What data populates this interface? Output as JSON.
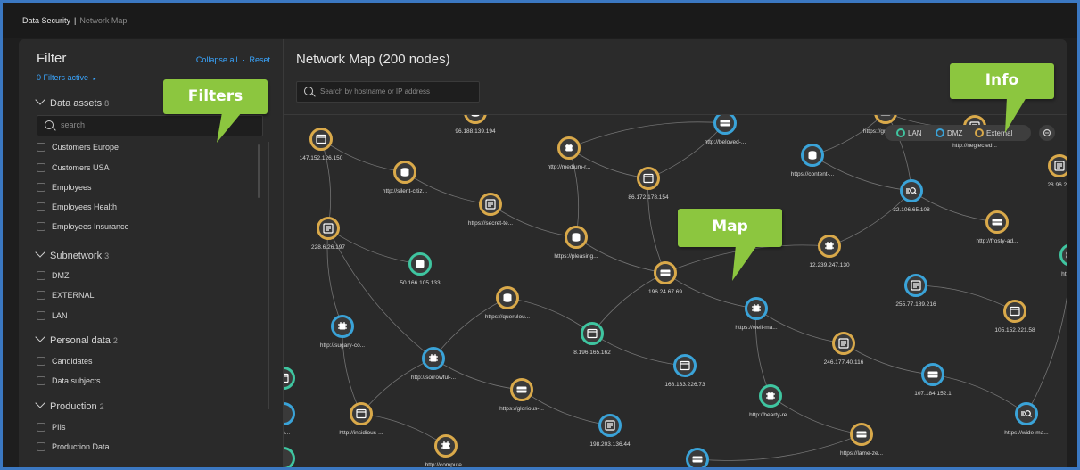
{
  "breadcrumb": {
    "root": "Data Security",
    "separator": "|",
    "current": "Network Map"
  },
  "filter": {
    "title": "Filter",
    "collapse_all": "Collapse all",
    "reset": "Reset",
    "active": "0 Filters active",
    "search_placeholder": "search",
    "groups": [
      {
        "label": "Data assets",
        "count": "8",
        "items": [
          "Customers Europe",
          "Customers USA",
          "Employees",
          "Employees Health",
          "Employees Insurance"
        ]
      },
      {
        "label": "Subnetwork",
        "count": "3",
        "items": [
          "DMZ",
          "EXTERNAL",
          "LAN"
        ]
      },
      {
        "label": "Personal data",
        "count": "2",
        "items": [
          "Candidates",
          "Data subjects"
        ]
      },
      {
        "label": "Production",
        "count": "2",
        "items": [
          "PIIs",
          "Production Data"
        ]
      }
    ]
  },
  "map": {
    "title": "Network Map (200 nodes)",
    "search_placeholder": "Search by hostname or IP address",
    "legend": [
      "LAN",
      "DMZ",
      "External"
    ],
    "nodes": [
      {
        "label": "96.188.139.194",
        "type": "external",
        "icon": "database"
      },
      {
        "label": "147.152.126.150",
        "type": "external",
        "icon": "window"
      },
      {
        "label": "http://beloved-...",
        "type": "dmz",
        "icon": "server"
      },
      {
        "label": "http://medium-r...",
        "type": "external",
        "icon": "chip"
      },
      {
        "label": "https://grove-ch...",
        "type": "external",
        "icon": "server"
      },
      {
        "label": "http://neglected...",
        "type": "external",
        "icon": "list"
      },
      {
        "label": "https://content-...",
        "type": "dmz",
        "icon": "database"
      },
      {
        "label": "http://silent-citiz...",
        "type": "external",
        "icon": "database"
      },
      {
        "label": "86.172.178.154",
        "type": "external",
        "icon": "window"
      },
      {
        "label": "32.106.65.108",
        "type": "dmz",
        "icon": "search"
      },
      {
        "label": "28.96.2...",
        "type": "external",
        "icon": "list"
      },
      {
        "label": "https://secret-te...",
        "type": "external",
        "icon": "list"
      },
      {
        "label": "228.6.26.197",
        "type": "external",
        "icon": "list"
      },
      {
        "label": "https://pleasing...",
        "type": "external",
        "icon": "database"
      },
      {
        "label": "http://frosty-ad...",
        "type": "external",
        "icon": "server"
      },
      {
        "label": "50.166.105.133",
        "type": "lan",
        "icon": "database"
      },
      {
        "label": "196.24.67.69",
        "type": "external",
        "icon": "server"
      },
      {
        "label": "12.239.247.130",
        "type": "external",
        "icon": "chip"
      },
      {
        "label": "http://...",
        "type": "lan",
        "icon": "server"
      },
      {
        "label": "255.77.189.216",
        "type": "dmz",
        "icon": "list"
      },
      {
        "label": "https://querulou...",
        "type": "external",
        "icon": "database"
      },
      {
        "label": "https://well-ma...",
        "type": "dmz",
        "icon": "chip"
      },
      {
        "label": "105.152.221.58",
        "type": "external",
        "icon": "window"
      },
      {
        "label": "http://sugary-co...",
        "type": "dmz",
        "icon": "chip"
      },
      {
        "label": "8.196.165.162",
        "type": "lan",
        "icon": "window"
      },
      {
        "label": "246.177.40.116",
        "type": "external",
        "icon": "list"
      },
      {
        "label": "http://sorrowful-...",
        "type": "dmz",
        "icon": "chip"
      },
      {
        "label": "168.133.226.73",
        "type": "dmz",
        "icon": "window"
      },
      {
        "label": "107.184.152.1",
        "type": "dmz",
        "icon": "server"
      },
      {
        "label": "https://glorious-...",
        "type": "external",
        "icon": "server"
      },
      {
        "label": "http://hearty-re...",
        "type": "lan",
        "icon": "chip"
      },
      {
        "label": "https://wide-ma...",
        "type": "dmz",
        "icon": "search"
      },
      {
        "label": "http://insidious-...",
        "type": "external",
        "icon": "window"
      },
      {
        "label": "198.203.136.44",
        "type": "dmz",
        "icon": "list"
      },
      {
        "label": "https://lame-ze...",
        "type": "external",
        "icon": "server"
      },
      {
        "label": "http://compute...",
        "type": "external",
        "icon": "chip"
      },
      {
        "label": "",
        "type": "dmz",
        "icon": "server"
      },
      {
        "label": "",
        "type": "lan",
        "icon": "window"
      },
      {
        "label": "om...",
        "type": "dmz",
        "icon": "none"
      },
      {
        "label": "",
        "type": "lan",
        "icon": "none"
      }
    ]
  },
  "callouts": {
    "filters": "Filters",
    "info": "Info",
    "map": "Map"
  },
  "colors": {
    "lan": "#3fc5a0",
    "dmz": "#3aa3d8",
    "external": "#d9a94a",
    "accent": "#3aa6ff",
    "callout": "#8cc63f"
  }
}
